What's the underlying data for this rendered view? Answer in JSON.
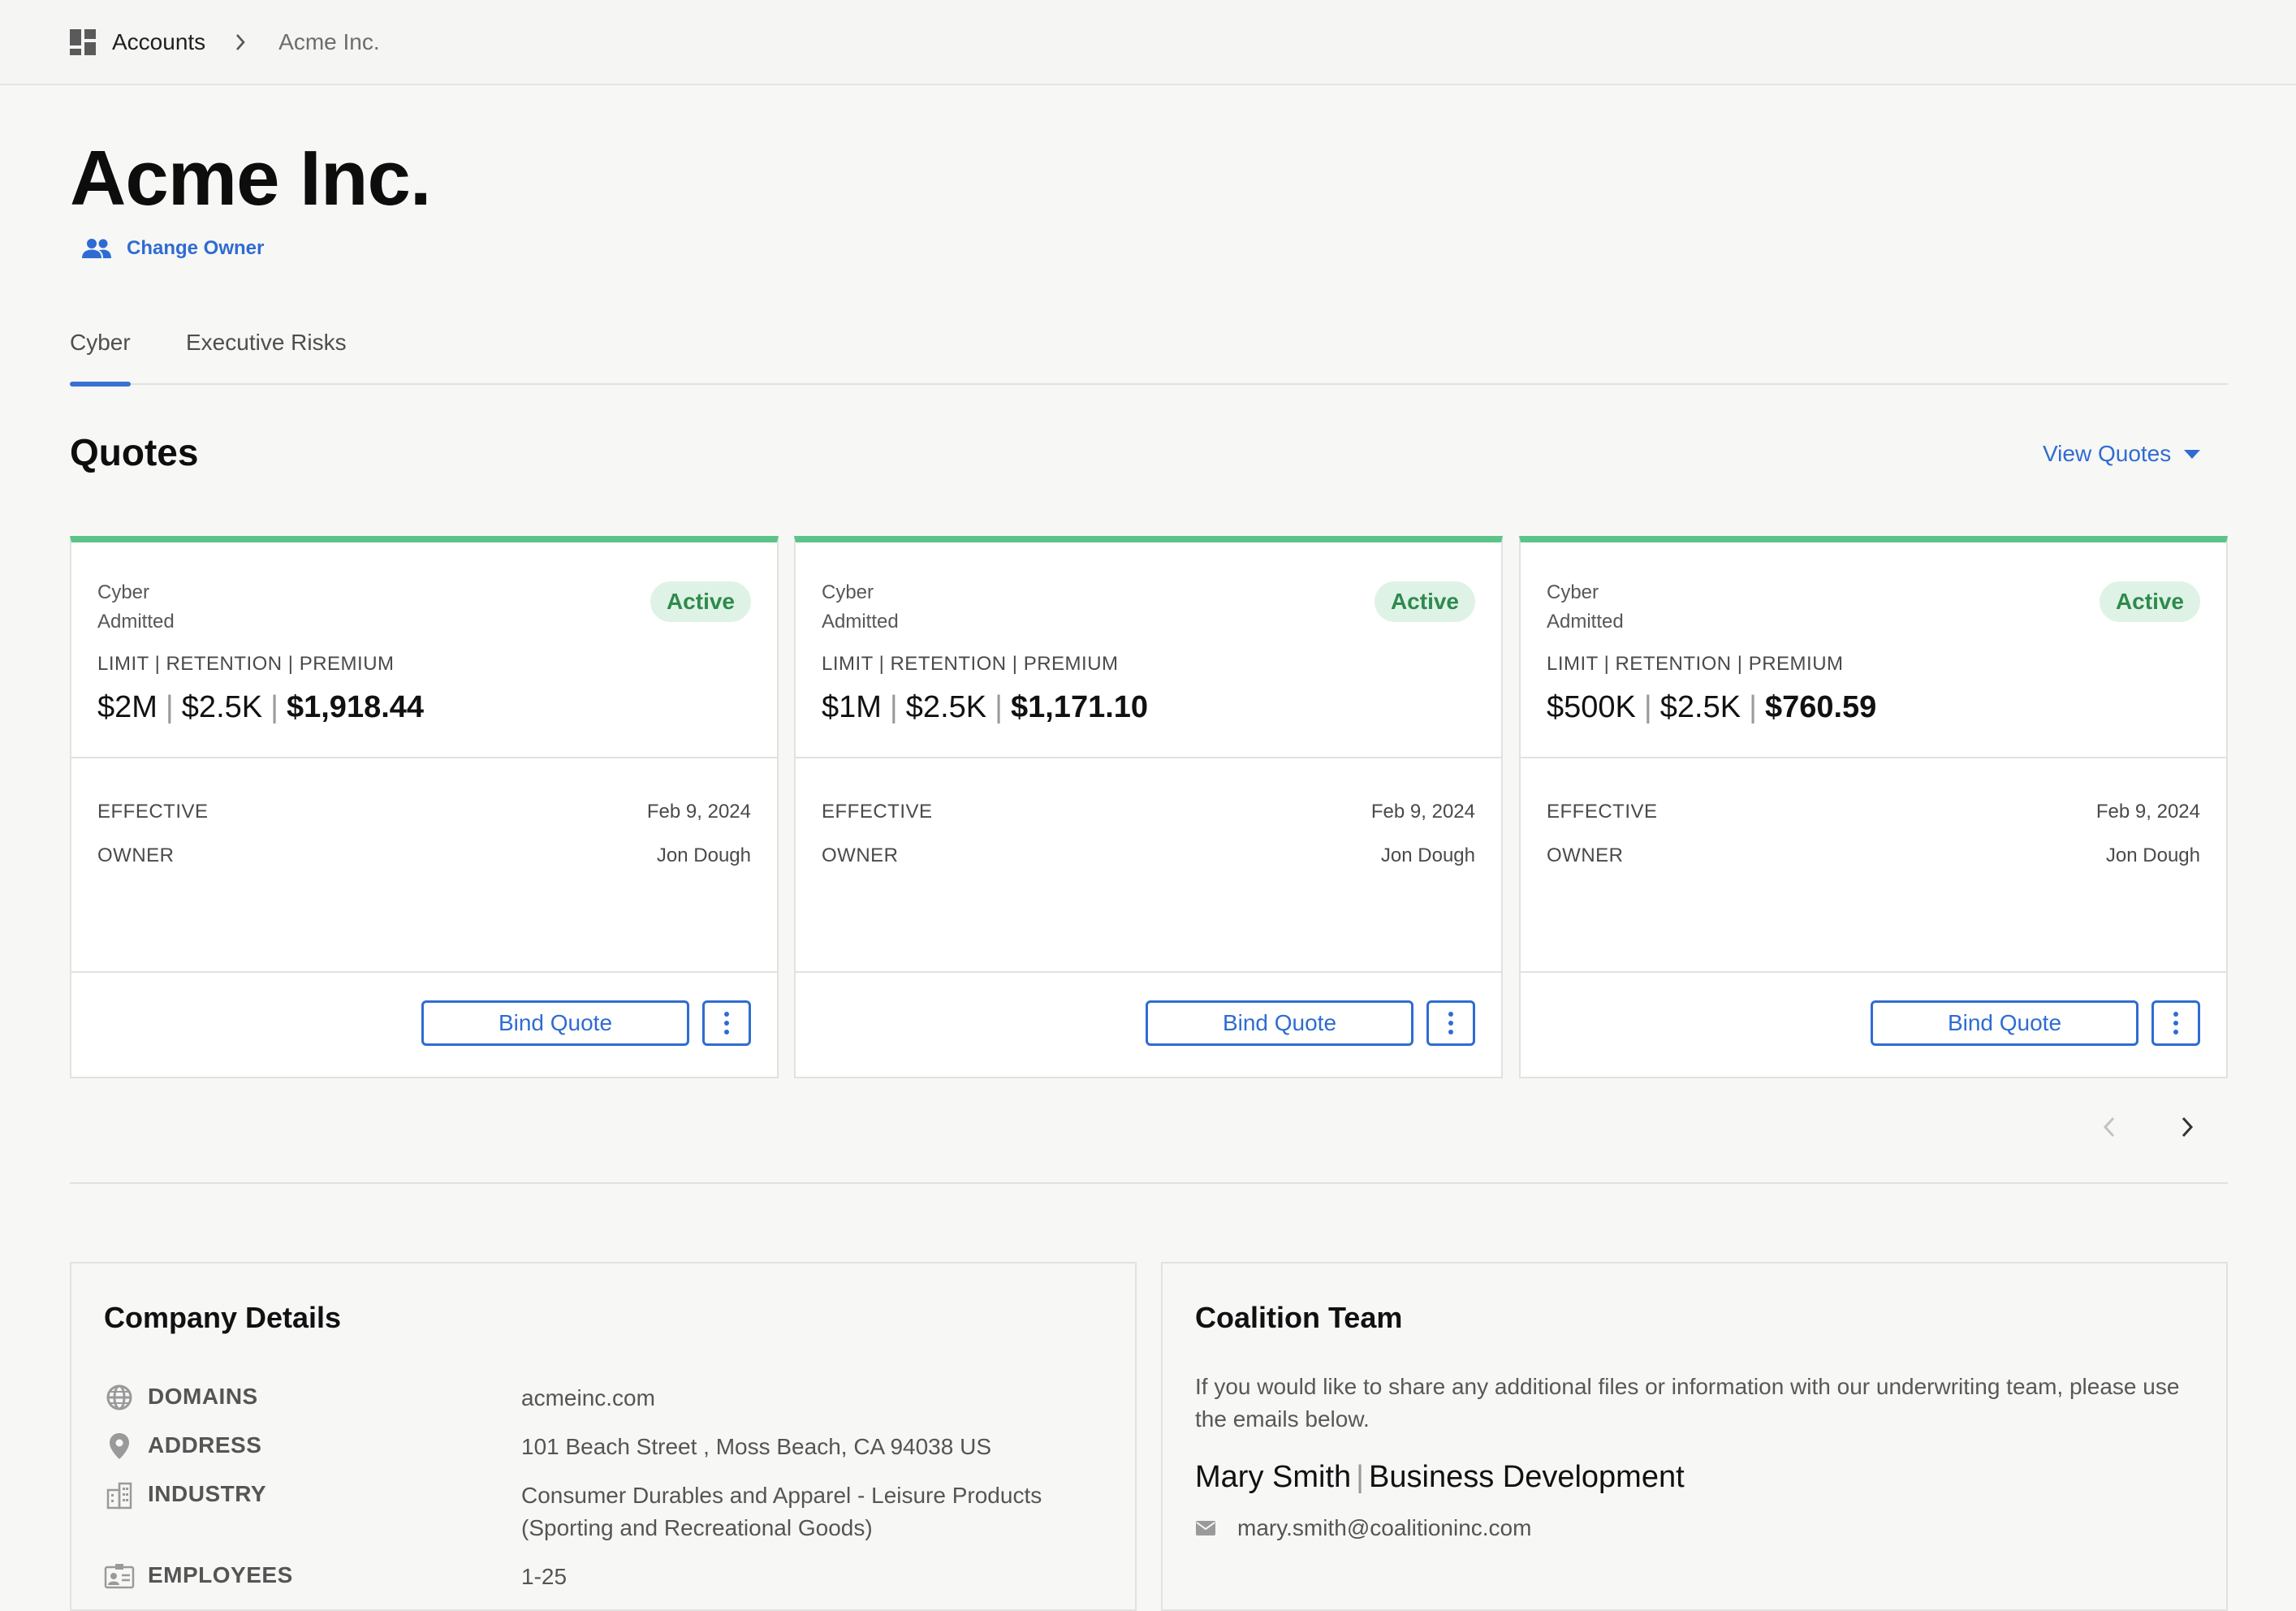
{
  "breadcrumb": {
    "icon": "dashboard-grid-icon",
    "root": "Accounts",
    "separator_icon": "chevron-right-icon",
    "current": "Acme Inc."
  },
  "page": {
    "title": "Acme Inc.",
    "change_owner": "Change Owner"
  },
  "tabs": [
    "Cyber",
    "Executive Risks"
  ],
  "active_tab": "Cyber",
  "quotes": {
    "title": "Quotes",
    "view_quotes": "View Quotes",
    "cards": [
      {
        "type_line1": "Cyber",
        "type_line2": "Admitted",
        "status": "Active",
        "lrp_label": "LIMIT | RETENTION | PREMIUM",
        "limit": "$2M",
        "retention": "$2.5K",
        "premium": "$1,918.44",
        "effective_label": "EFFECTIVE",
        "effective_value": "Feb 9, 2024",
        "owner_label": "OWNER",
        "owner_value": "Jon Dough",
        "bind_label": "Bind Quote"
      },
      {
        "type_line1": "Cyber",
        "type_line2": "Admitted",
        "status": "Active",
        "lrp_label": "LIMIT | RETENTION | PREMIUM",
        "limit": "$1M",
        "retention": "$2.5K",
        "premium": "$1,171.10",
        "effective_label": "EFFECTIVE",
        "effective_value": "Feb 9, 2024",
        "owner_label": "OWNER",
        "owner_value": "Jon Dough",
        "bind_label": "Bind Quote"
      },
      {
        "type_line1": "Cyber",
        "type_line2": "Admitted",
        "status": "Active",
        "lrp_label": "LIMIT | RETENTION | PREMIUM",
        "limit": "$500K",
        "retention": "$2.5K",
        "premium": "$760.59",
        "effective_label": "EFFECTIVE",
        "effective_value": "Feb 9, 2024",
        "owner_label": "OWNER",
        "owner_value": "Jon Dough",
        "bind_label": "Bind Quote"
      }
    ]
  },
  "company_details": {
    "title": "Company Details",
    "rows": [
      {
        "icon": "globe-icon",
        "label": "DOMAINS",
        "value": "acmeinc.com"
      },
      {
        "icon": "location-pin-icon",
        "label": "ADDRESS",
        "value": "101 Beach Street , Moss Beach, CA 94038 US"
      },
      {
        "icon": "industry-building-icon",
        "label": "INDUSTRY",
        "value": "Consumer Durables and Apparel - Leisure Products (Sporting and Recreational Goods)"
      },
      {
        "icon": "id-card-icon",
        "label": "EMPLOYEES",
        "value": "1-25"
      }
    ]
  },
  "coalition_team": {
    "title": "Coalition Team",
    "description": "If you would like to share any additional files or information with our underwriting team, please use the emails below.",
    "person_name": "Mary Smith",
    "person_role": "Business Development",
    "email": "mary.smith@coalitioninc.com"
  },
  "colors": {
    "accent": "#2f6cd1",
    "active_green": "#5cc389",
    "badge_bg": "#dff2e6",
    "badge_text": "#2e8a4d",
    "background": "#f7f7f6"
  }
}
